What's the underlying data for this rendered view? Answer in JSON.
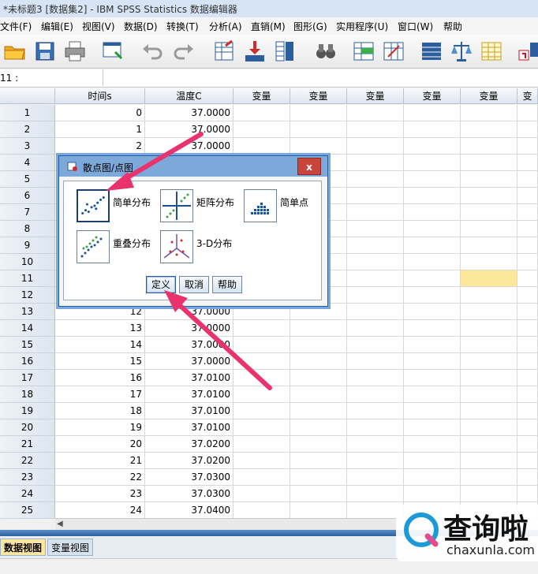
{
  "window": {
    "title": "*未标题3 [数据集2] - IBM SPSS Statistics 数据编辑器"
  },
  "menu": [
    "文件(F)",
    "编辑(E)",
    "视图(V)",
    "数据(D)",
    "转换(T)",
    "分析(A)",
    "直销(M)",
    "图形(G)",
    "实用程序(U)",
    "窗口(W)",
    "帮助"
  ],
  "cell_ref": {
    "label": "11 :",
    "value": ""
  },
  "columns": [
    "时间s",
    "温度C",
    "变量",
    "变量",
    "变量",
    "变量",
    "变量",
    "变"
  ],
  "rows": [
    {
      "n": "1",
      "time": "0",
      "temp": "37.0000"
    },
    {
      "n": "2",
      "time": "1",
      "temp": "37.0000"
    },
    {
      "n": "3",
      "time": "2",
      "temp": "37.0000"
    },
    {
      "n": "4",
      "time": "",
      "temp": ""
    },
    {
      "n": "5",
      "time": "",
      "temp": ""
    },
    {
      "n": "6",
      "time": "",
      "temp": ""
    },
    {
      "n": "7",
      "time": "",
      "temp": ""
    },
    {
      "n": "8",
      "time": "",
      "temp": ""
    },
    {
      "n": "9",
      "time": "",
      "temp": ""
    },
    {
      "n": "10",
      "time": "",
      "temp": ""
    },
    {
      "n": "11",
      "time": "",
      "temp": ""
    },
    {
      "n": "12",
      "time": "",
      "temp": ""
    },
    {
      "n": "13",
      "time": "12",
      "temp": "37.0000"
    },
    {
      "n": "14",
      "time": "13",
      "temp": "37.0000"
    },
    {
      "n": "15",
      "time": "14",
      "temp": "37.0000"
    },
    {
      "n": "16",
      "time": "15",
      "temp": "37.0000"
    },
    {
      "n": "17",
      "time": "16",
      "temp": "37.0100"
    },
    {
      "n": "18",
      "time": "17",
      "temp": "37.0100"
    },
    {
      "n": "19",
      "time": "18",
      "temp": "37.0100"
    },
    {
      "n": "20",
      "time": "19",
      "temp": "37.0100"
    },
    {
      "n": "21",
      "time": "20",
      "temp": "37.0200"
    },
    {
      "n": "22",
      "time": "21",
      "temp": "37.0200"
    },
    {
      "n": "23",
      "time": "22",
      "temp": "37.0300"
    },
    {
      "n": "24",
      "time": "23",
      "temp": "37.0300"
    },
    {
      "n": "25",
      "time": "24",
      "temp": "37.0400"
    }
  ],
  "dialog": {
    "title": "散点图/点图",
    "close": "x",
    "options": {
      "simple": "简单分布",
      "matrix": "矩阵分布",
      "dot": "简单点",
      "overlay": "重叠分布",
      "three_d": "3-D分布"
    },
    "buttons": {
      "define": "定义",
      "cancel": "取消",
      "help": "帮助"
    }
  },
  "tabs": {
    "data_view": "数据视图",
    "variable_view": "变量视图"
  },
  "watermark": {
    "cn": "查询啦",
    "en": "chaxunla.com"
  },
  "colors": {
    "accent": "#e8336d",
    "highlight_cell": "#fce79a",
    "active_tab": "#fbe7a1"
  }
}
